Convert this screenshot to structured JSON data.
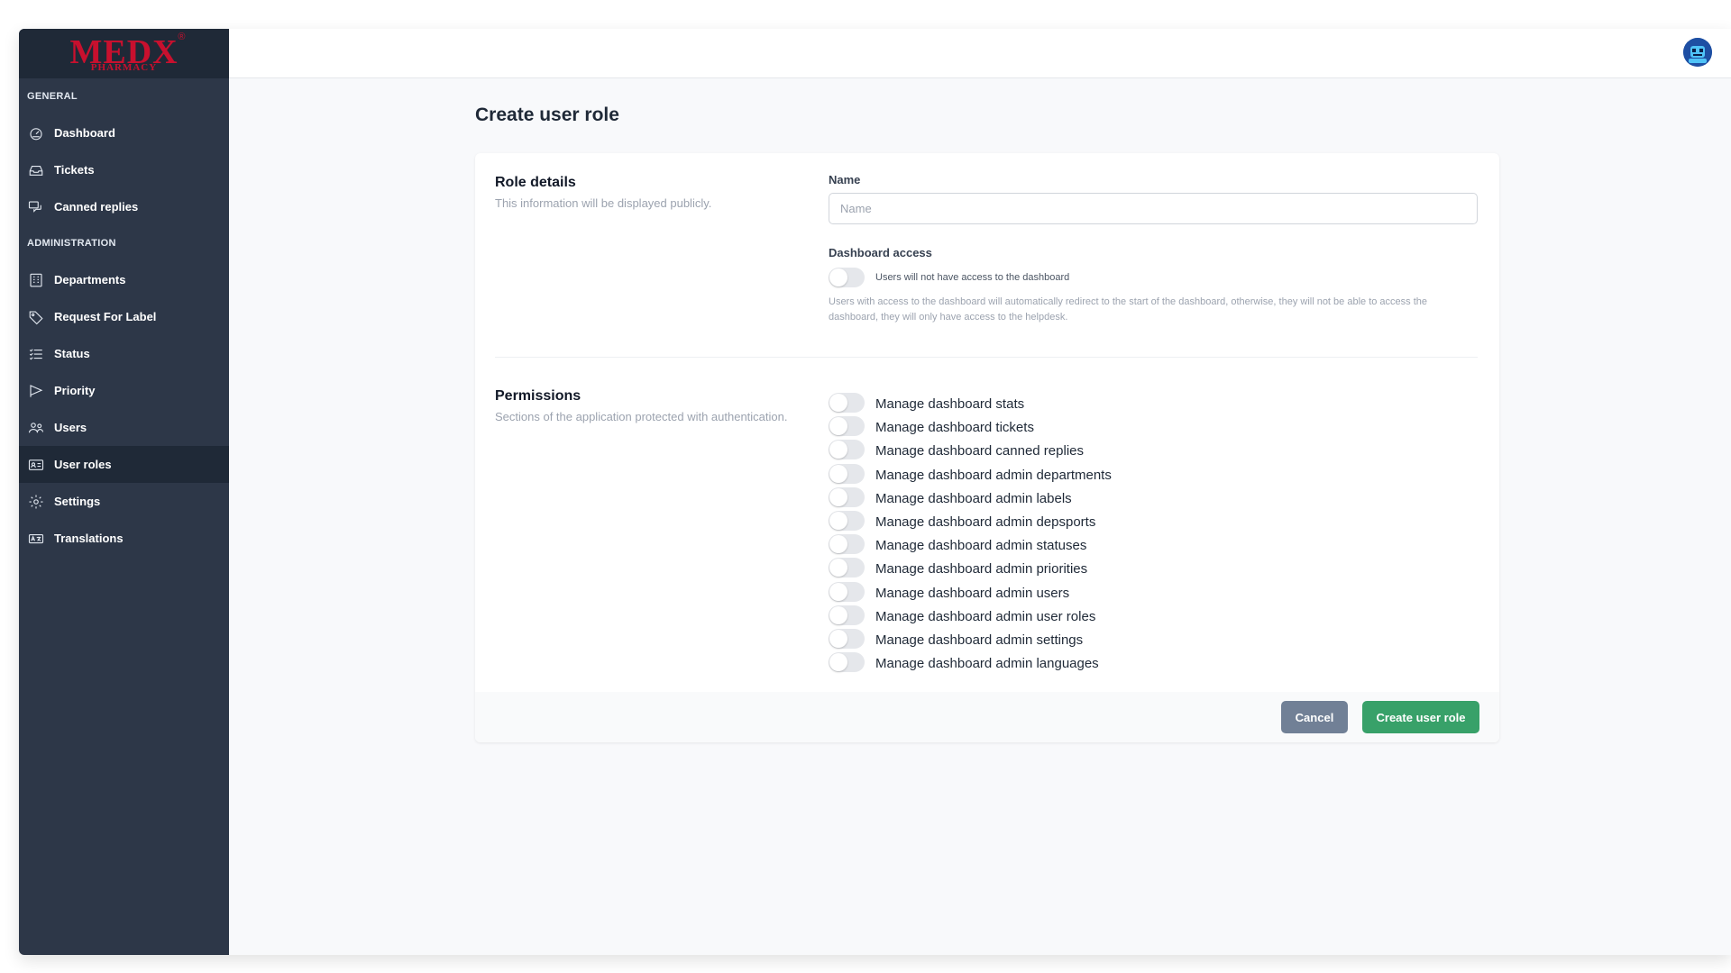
{
  "brand": {
    "name": "MEDX",
    "sub": "PHARMACY",
    "reg": "®"
  },
  "sidebar": {
    "general_label": "GENERAL",
    "admin_label": "ADMINISTRATION",
    "general_items": [
      {
        "label": "Dashboard",
        "icon": "gauge-icon"
      },
      {
        "label": "Tickets",
        "icon": "inbox-icon"
      },
      {
        "label": "Canned replies",
        "icon": "chat-bubbles-icon"
      }
    ],
    "admin_items": [
      {
        "label": "Departments",
        "icon": "building-icon"
      },
      {
        "label": "Request For Label",
        "icon": "tag-icon"
      },
      {
        "label": "Status",
        "icon": "list-icon"
      },
      {
        "label": "Priority",
        "icon": "flag-icon"
      },
      {
        "label": "Users",
        "icon": "users-icon"
      },
      {
        "label": "User roles",
        "icon": "id-card-icon",
        "active": true
      },
      {
        "label": "Settings",
        "icon": "gear-icon"
      },
      {
        "label": "Translations",
        "icon": "translate-icon"
      }
    ]
  },
  "page": {
    "title": "Create user role"
  },
  "role_details": {
    "title": "Role details",
    "description": "This information will be displayed publicly.",
    "name_label": "Name",
    "name_placeholder": "Name",
    "name_value": "",
    "dashboard_access_label": "Dashboard access",
    "dashboard_access_state": "Users will not have access to the dashboard",
    "dashboard_access_help": "Users with access to the dashboard will automatically redirect to the start of the dashboard, otherwise, they will not be able to access the dashboard, they will only have access to the helpdesk."
  },
  "permissions": {
    "title": "Permissions",
    "description": "Sections of the application protected with authentication.",
    "items": [
      "Manage dashboard stats",
      "Manage dashboard tickets",
      "Manage dashboard canned replies",
      "Manage dashboard admin departments",
      "Manage dashboard admin labels",
      "Manage dashboard admin depsports",
      "Manage dashboard admin statuses",
      "Manage dashboard admin priorities",
      "Manage dashboard admin users",
      "Manage dashboard admin user roles",
      "Manage dashboard admin settings",
      "Manage dashboard admin languages"
    ]
  },
  "actions": {
    "cancel": "Cancel",
    "create": "Create user role"
  },
  "colors": {
    "sidebar": "#2d3748",
    "accent_green": "#38a169",
    "cancel_gray": "#718096",
    "brand_red": "#c8102e"
  }
}
